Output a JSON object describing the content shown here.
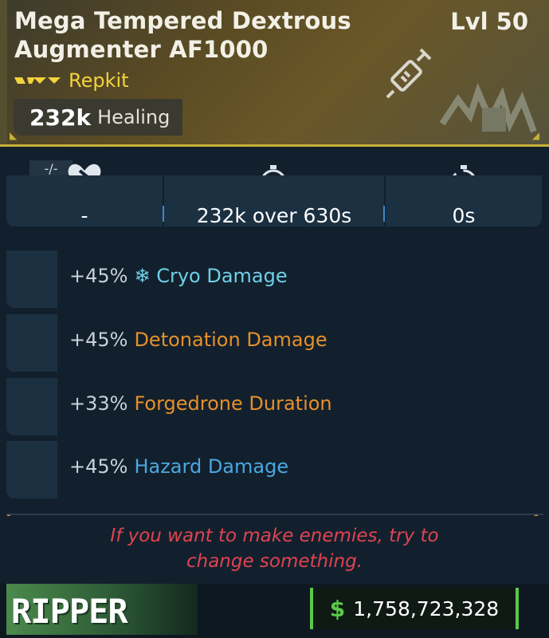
{
  "item": {
    "name": "Mega Tempered Dextrous Augmenter AF1000",
    "level": "Lvl 50",
    "rarity": "Repkit",
    "main_stat_value": "232k",
    "main_stat_label": "Healing",
    "icon": "syringe-icon",
    "manufacturer_logo": "manufacturer-logo"
  },
  "stats": {
    "badge": "-/-",
    "cells": [
      {
        "icon": "heart-broken-icon",
        "value": "-"
      },
      {
        "icon": "regen-timer-icon",
        "value": "232k over 630s"
      },
      {
        "icon": "cooldown-timer-icon",
        "value": "0s"
      }
    ]
  },
  "perks": [
    {
      "value": "+45%",
      "icon": "snowflake-icon",
      "name": "Cryo Damage",
      "color": "#6fd0e6"
    },
    {
      "value": "+45%",
      "name": "Detonation Damage",
      "color": "#e6902a"
    },
    {
      "value": "+33%",
      "name": "Forgedrone Duration",
      "color": "#e6902a"
    },
    {
      "value": "+45%",
      "name": "Hazard Damage",
      "color": "#4aa8e0"
    }
  ],
  "flavor_text": [
    "If you want to make enemies, try to",
    "change something."
  ],
  "footer": {
    "brand": "RIPPER",
    "currency_symbol": "$",
    "price": "1,758,723,328"
  },
  "colors": {
    "rarity_yellow": "#f3d33b",
    "header_gold": "#c9b03a",
    "money_green": "#59c94a",
    "flavor_red": "#e0434f"
  }
}
